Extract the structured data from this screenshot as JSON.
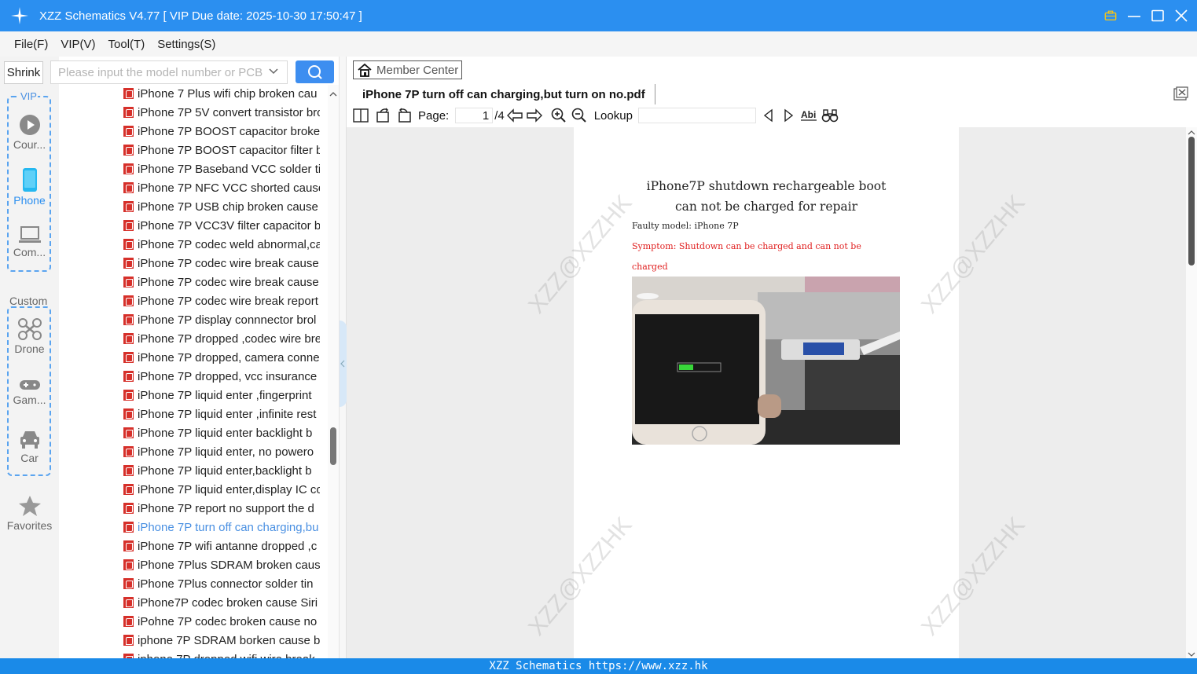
{
  "window": {
    "title": "XZZ Schematics V4.77 [ VIP Due date: 2025-10-30 17:50:47 ]"
  },
  "menu": [
    "File(F)",
    "VIP(V)",
    "Tool(T)",
    "Settings(S)"
  ],
  "sidebar": {
    "shrink_label": "Shrink",
    "search_placeholder": "Please input the model number or PCB",
    "vip_label": "VIP",
    "custom_label": "Custom",
    "vip_items": [
      {
        "label": "Cour...",
        "icon": "play-circle-icon"
      },
      {
        "label": "Phone",
        "icon": "phone-icon",
        "active": true
      },
      {
        "label": "Com...",
        "icon": "laptop-icon"
      }
    ],
    "custom_items": [
      {
        "label": "Drone",
        "icon": "drone-icon"
      },
      {
        "label": "Gam...",
        "icon": "gamepad-icon"
      },
      {
        "label": "Car",
        "icon": "car-icon"
      }
    ],
    "favorites_label": "Favorites"
  },
  "files": [
    "iPhone 7 Plus wifi chip broken cau",
    "iPhone 7P 5V convert transistor bro",
    "iPhone 7P BOOST capacitor broken",
    "iPhone 7P BOOST capacitor filter b",
    "iPhone 7P Baseband VCC solder tin",
    "iPhone 7P NFC VCC shorted cause",
    "iPhone 7P USB chip broken cause",
    "iPhone 7P VCC3V filter capacitor b",
    "iPhone 7P codec weld abnormal,ca",
    "iPhone 7P codec wire break cause",
    "iPhone 7P codec wire break cause",
    "iPhone 7P codec wire break report",
    "iPhone 7P display connnector brol",
    "iPhone 7P dropped ,codec wire bre",
    "iPhone 7P dropped, camera conne",
    "iPhone 7P dropped, vcc insurance",
    "iPhone 7P liquid enter ,fingerprint",
    "iPhone 7P liquid enter ,infinite rest",
    "iPhone 7P liquid enter backlight b",
    "iPhone 7P liquid enter, no powero",
    "iPhone 7P liquid enter,backlight b",
    "iPhone 7P liquid enter,display IC co",
    "iPhone 7P report no support the d",
    "iPhone 7P turn off can charging,bu",
    "iPhone 7P wifi antanne dropped ,c",
    "iPhone 7Plus SDRAM broken caus",
    "iPhone 7Plus connector solder tin",
    "iPhone7P codec broken cause Siri",
    "iPohne 7P codec broken cause no",
    "iphone 7P SDRAM borken cause b",
    "iphone 7P dropped wifi wire break"
  ],
  "active_file_index": 23,
  "viewer": {
    "member_center": "Member Center",
    "doc_tab": "iPhone 7P turn off can charging,but turn on no.pdf",
    "page_label": "Page:",
    "page_current": "1",
    "page_total": "/4",
    "lookup_label": "Lookup"
  },
  "document": {
    "title_line1": "iPhone7P shutdown rechargeable boot",
    "title_line2": "can not be charged for repair",
    "faulty_model": "Faulty model: iPhone 7P",
    "symptom_line1": "Symptom: Shutdown can be charged and can not be",
    "symptom_line2": "charged",
    "watermark": "XZZ@XZZHK"
  },
  "statusbar": "XZZ Schematics https://www.xzz.hk",
  "colors": {
    "titlebar": "#2b8ff0",
    "accent": "#3d8ef0",
    "active_file": "#4a90e2",
    "pdf_red": "#d6302a",
    "symptom_red": "#e02020"
  }
}
